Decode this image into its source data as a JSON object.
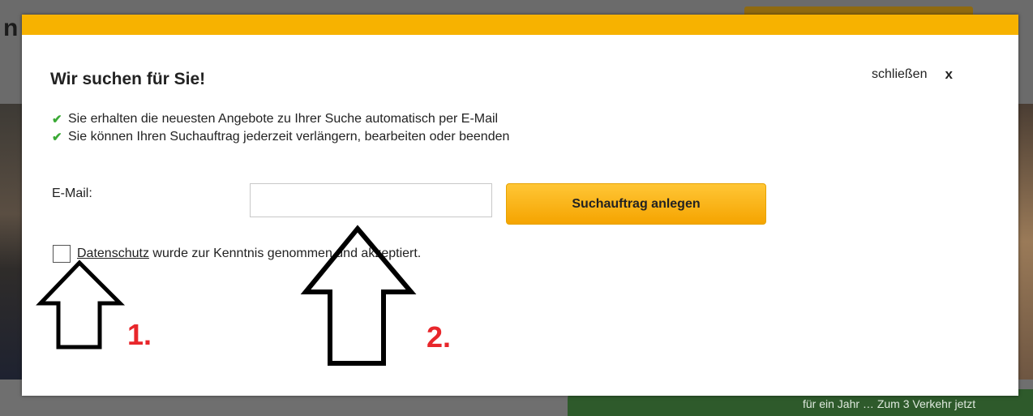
{
  "modal": {
    "title": "Wir suchen für Sie!",
    "close_label": "schließen",
    "close_icon": "x"
  },
  "benefits": [
    {
      "icon": "check-icon",
      "text": "Sie erhalten die neuesten Angebote zu Ihrer Suche automatisch per E-Mail"
    },
    {
      "icon": "check-icon",
      "text": "Sie können Ihren Suchauftrag jederzeit verlängern, bearbeiten oder beenden"
    }
  ],
  "form": {
    "email_label": "E-Mail:",
    "email_value": "",
    "submit_label": "Suchauftrag anlegen",
    "consent_checked": false,
    "privacy_link": "Datenschutz",
    "consent_text": " wurde zur Kenntnis genommen und akzeptiert."
  },
  "annotations": [
    {
      "label": "1."
    },
    {
      "label": "2."
    }
  ],
  "background": {
    "partial_letter": "n",
    "green_bar_text": "für ein Jahr … Zum 3 Verkehr jetzt"
  },
  "colors": {
    "accent": "#f7b200",
    "check": "#3aa935",
    "annotation": "#e8262b"
  }
}
